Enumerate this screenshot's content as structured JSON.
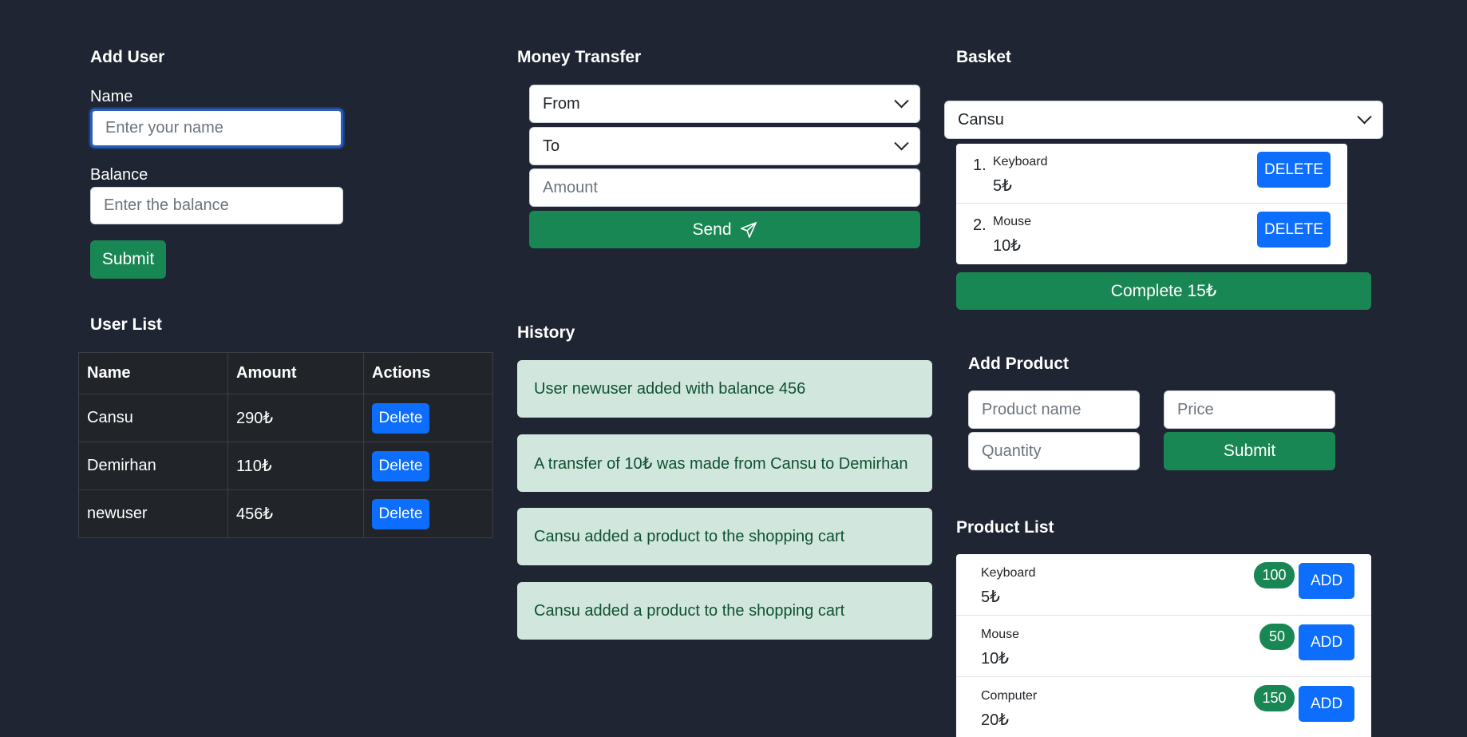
{
  "add_user": {
    "title": "Add User",
    "name_label": "Name",
    "name_placeholder": "Enter your name",
    "balance_label": "Balance",
    "balance_placeholder": "Enter the balance",
    "submit": "Submit"
  },
  "user_list": {
    "title": "User List",
    "headers": [
      "Name",
      "Amount",
      "Actions"
    ],
    "rows": [
      {
        "name": "Cansu",
        "amount": "290₺",
        "action": "Delete"
      },
      {
        "name": "Demirhan",
        "amount": "110₺",
        "action": "Delete"
      },
      {
        "name": "newuser",
        "amount": "456₺",
        "action": "Delete"
      }
    ]
  },
  "money_transfer": {
    "title": "Money Transfer",
    "from": "From",
    "to": "To",
    "amount_placeholder": "Amount",
    "send": "Send",
    "send_icon": "paper-plane-icon"
  },
  "history": {
    "title": "History",
    "items": [
      "User newuser added with balance 456",
      "A transfer of 10₺ was made from Cansu to Demirhan",
      "Cansu added a product to the shopping cart",
      "Cansu added a product to the shopping cart"
    ]
  },
  "basket": {
    "title": "Basket",
    "selected_user": "Cansu",
    "items": [
      {
        "index": "1.",
        "name": "Keyboard",
        "price": "5₺",
        "action": "DELETE"
      },
      {
        "index": "2.",
        "name": "Mouse",
        "price": "10₺",
        "action": "DELETE"
      }
    ],
    "complete": "Complete 15₺"
  },
  "add_product": {
    "title": "Add Product",
    "name_placeholder": "Product name",
    "price_placeholder": "Price",
    "quantity_placeholder": "Quantity",
    "submit": "Submit"
  },
  "product_list": {
    "title": "Product List",
    "items": [
      {
        "name": "Keyboard",
        "price": "5₺",
        "stock": "100",
        "action": "ADD"
      },
      {
        "name": "Mouse",
        "price": "10₺",
        "stock": "50",
        "action": "ADD"
      },
      {
        "name": "Computer",
        "price": "20₺",
        "stock": "150",
        "action": "ADD"
      }
    ]
  },
  "colors": {
    "background": "#1f2532",
    "success": "#198754",
    "primary": "#0d6efd",
    "history_bg": "#d1e7dd",
    "history_text": "#0f5132"
  }
}
